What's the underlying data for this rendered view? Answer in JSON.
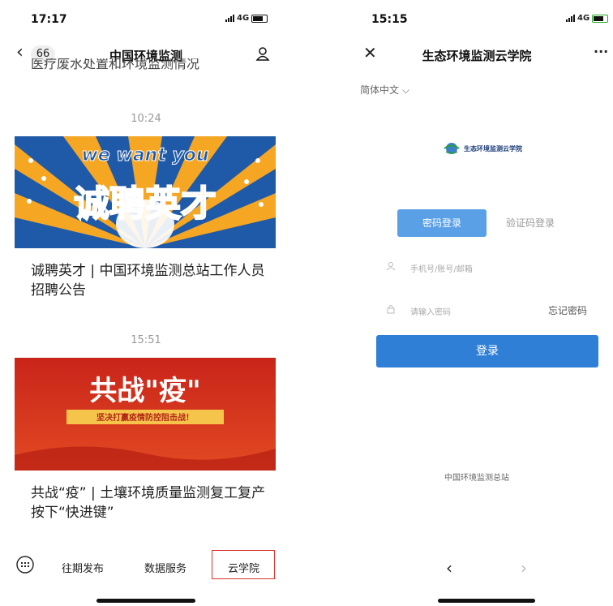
{
  "left": {
    "status_time": "17:17",
    "network": "4G",
    "back_count": "66",
    "title": "中国环境监测",
    "cut_text": "医疗废水处置和环境监测情况",
    "articles": [
      {
        "time": "10:24",
        "banner_top": "we want you",
        "banner_main": "诚聘英才",
        "title": "诚聘英才 | 中国环境监测总站工作人员招聘公告"
      },
      {
        "time": "15:51",
        "banner_main": "共战\"疫\"",
        "banner_sub": "坚决打赢疫情防控阻击战！",
        "title": "共战“疫” | 土壤环境质量监测复工复产按下“快进键”"
      }
    ],
    "menu": {
      "item1": "往期发布",
      "item2": "数据服务",
      "item3": "云学院"
    }
  },
  "right": {
    "status_time": "15:15",
    "network": "4G",
    "title": "生态环境监测云学院",
    "more": "···",
    "language": "简体中文",
    "logo_text": "生态环境监测云学院",
    "tabs": {
      "password": "密码登录",
      "code": "验证码登录"
    },
    "fields": {
      "account_placeholder": "手机号/账号/邮箱",
      "password_placeholder": "请输入密码"
    },
    "forgot": "忘记密码",
    "login": "登录",
    "footer": "中国环境监测总站",
    "nav": {
      "back": "‹",
      "forward": "›"
    }
  },
  "colors": {
    "accent_red": "#d9322c",
    "login_blue": "#2f7fd6",
    "tab_blue": "#5aa0e6",
    "banner_blue": "#1f5aa8",
    "banner_yellow": "#f5a623",
    "banner_red": "#d8321f"
  }
}
